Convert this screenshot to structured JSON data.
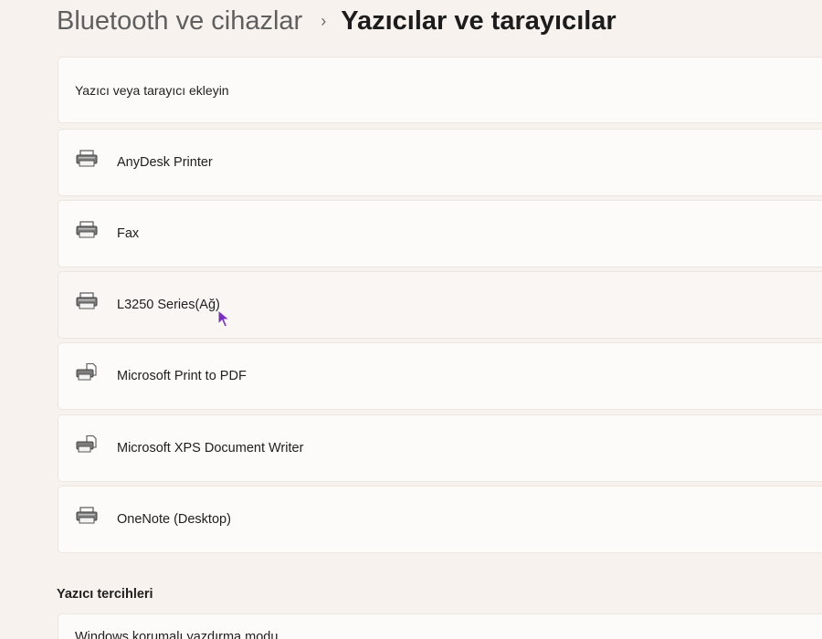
{
  "breadcrumb": {
    "parent": "Bluetooth ve cihazlar",
    "separator": "›",
    "current": "Yazıcılar ve tarayıcılar"
  },
  "add_device": {
    "label": "Yazıcı veya tarayıcı ekleyin"
  },
  "printers": [
    {
      "name": "AnyDesk Printer",
      "icon": "printer-icon"
    },
    {
      "name": "Fax",
      "icon": "printer-icon"
    },
    {
      "name": "L3250 Series(Ağ)",
      "icon": "printer-icon",
      "hovered": true
    },
    {
      "name": "Microsoft Print to PDF",
      "icon": "printer-document-icon"
    },
    {
      "name": "Microsoft XPS Document Writer",
      "icon": "printer-document-icon"
    },
    {
      "name": "OneNote (Desktop)",
      "icon": "printer-icon"
    }
  ],
  "preferences": {
    "title": "Yazıcı tercihleri",
    "items": [
      {
        "label": "Windows korumalı yazdırma modu"
      }
    ]
  },
  "colors": {
    "accent_cursor": "#7b2fbf",
    "background": "#f8f2ee",
    "card": "#fdfbf9"
  }
}
